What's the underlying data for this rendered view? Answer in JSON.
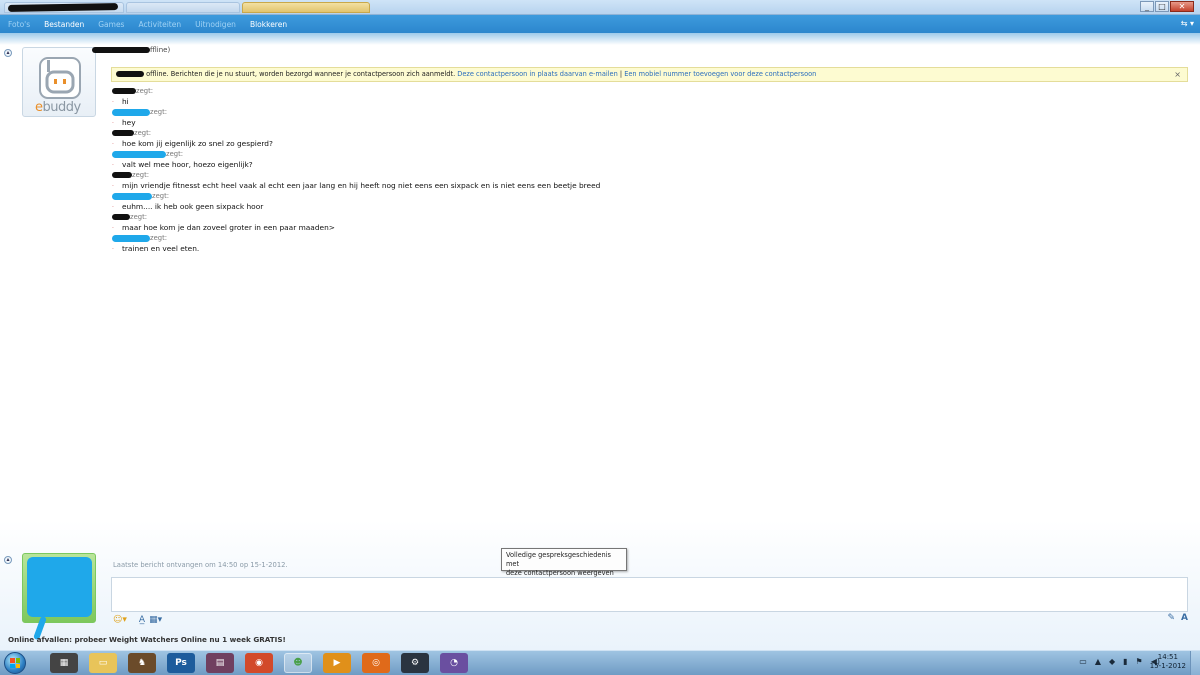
{
  "window": {
    "buttons": [
      "_",
      "□",
      "✕"
    ]
  },
  "menu": {
    "items": [
      {
        "label": "Foto's",
        "active": false
      },
      {
        "label": "Bestanden",
        "active": true
      },
      {
        "label": "Games",
        "active": false
      },
      {
        "label": "Activiteiten",
        "active": false
      },
      {
        "label": "Uitnodigen",
        "active": false
      },
      {
        "label": "Blokkeren",
        "active": true
      }
    ],
    "right_icon": "⇆ ▾"
  },
  "contact": {
    "status_suffix": "ffline)",
    "logo_text_e": "e",
    "logo_text_rest": "buddy"
  },
  "notification": {
    "text": " offline. Berichten die je nu stuurt, worden bezorgd wanneer je contactpersoon zich aanmeldt.",
    "link1": "Deze contactpersoon in plaats daarvan e-mailen",
    "separator": " | ",
    "link2": "Een mobiel nummer toevoegen voor deze contactpersoon",
    "close": "×"
  },
  "messages": [
    {
      "sender_color": "black",
      "says": "zegt:",
      "text": "hi"
    },
    {
      "sender_color": "blue",
      "says": "zegt:",
      "text": "hey"
    },
    {
      "sender_color": "black",
      "says": "zegt:",
      "text": "hoe kom jij eigenlijk zo snel zo gespierd?"
    },
    {
      "sender_color": "blue",
      "says": "zegt:",
      "text": "valt wel mee hoor, hoezo eigenlijk?"
    },
    {
      "sender_color": "black",
      "says": "zegt:",
      "text": "mijn vriendje fitnesst echt heel vaak al echt een jaar lang en hij heeft nog niet eens een sixpack en is niet eens een beetje breed"
    },
    {
      "sender_color": "blue",
      "says": "zegt:",
      "text": "euhm.... ik heb ook geen sixpack hoor"
    },
    {
      "sender_color": "black",
      "says": "zegt:",
      "text": "maar hoe kom je dan zoveel groter in een paar maaden>"
    },
    {
      "sender_color": "blue",
      "says": "zegt:",
      "text": "trainen en veel eten."
    }
  ],
  "bottom": {
    "last_message": "Laatste bericht ontvangen om 14:50 op 15-1-2012.",
    "tooltip_line1": "Volledige gespreksgeschiedenis met",
    "tooltip_line2": "deze contactpersoon weergeven",
    "ad_text": "Online afvallen: probeer Weight Watchers Online nu 1 week GRATIS!"
  },
  "toolbar": {
    "smiley": "☺▾",
    "font": "A̲",
    "color": "▦▾",
    "pen": "✎",
    "font_size": "A"
  },
  "taskbar": {
    "icons": [
      {
        "name": "qr-app-icon",
        "glyph": "▦",
        "color": "#444444"
      },
      {
        "name": "file-explorer-icon",
        "glyph": "▭",
        "color": "#e8c45a"
      },
      {
        "name": "character-icon",
        "glyph": "♞",
        "color": "#6b4b2a"
      },
      {
        "name": "photoshop-icon",
        "glyph": "Ps",
        "color": "#1d5c9c"
      },
      {
        "name": "media-icon",
        "glyph": "▤",
        "color": "#704060"
      },
      {
        "name": "chrome-icon",
        "glyph": "◉",
        "color": "#d24a2a"
      },
      {
        "name": "messenger-icon",
        "glyph": "☻",
        "color": "#4aa04a"
      },
      {
        "name": "media-player-icon",
        "glyph": "▶",
        "color": "#e0901a"
      },
      {
        "name": "firefox-icon",
        "glyph": "◎",
        "color": "#e06a1a"
      },
      {
        "name": "steam-icon",
        "glyph": "⚙",
        "color": "#2a3440"
      },
      {
        "name": "bittorrent-icon",
        "glyph": "◔",
        "color": "#6a4fa0"
      }
    ],
    "tray_icons": [
      "▭",
      "▲",
      "◆",
      "▮",
      "⚑",
      "◀)"
    ],
    "time": "14:51",
    "date": "15-1-2012"
  }
}
